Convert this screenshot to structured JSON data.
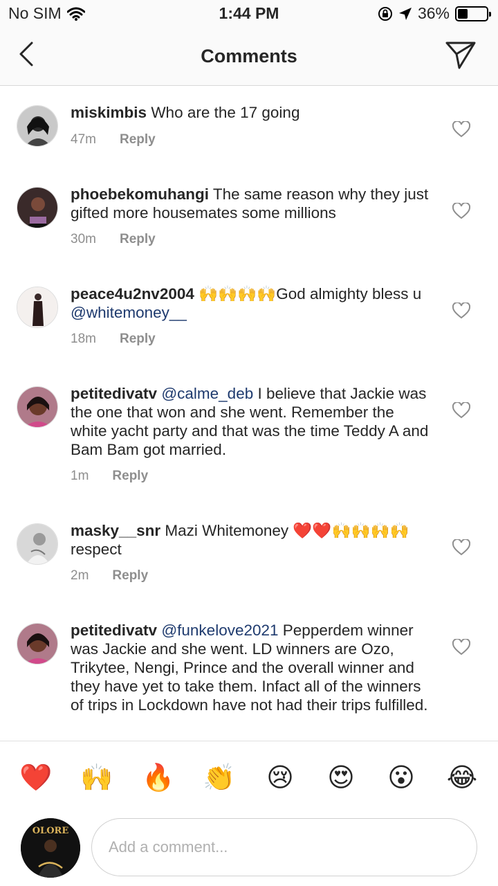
{
  "status_bar": {
    "carrier": "No SIM",
    "time": "1:44 PM",
    "battery_text": "36%",
    "battery_level": 0.36
  },
  "header": {
    "title": "Comments"
  },
  "comments": [
    {
      "user": "miskimbis",
      "parts": [
        {
          "type": "text",
          "value": " Who are the 17 going"
        }
      ],
      "time": "47m",
      "reply": "Reply"
    },
    {
      "user": "phoebekomuhangi",
      "parts": [
        {
          "type": "text",
          "value": " The same reason why they just gifted more housemates some millions"
        }
      ],
      "time": "30m",
      "reply": "Reply"
    },
    {
      "user": "peace4u2nv2004",
      "parts": [
        {
          "type": "text",
          "value": " 🙌🙌🙌🙌God almighty bless u "
        },
        {
          "type": "mention",
          "value": "@whitemoney__"
        }
      ],
      "time": "18m",
      "reply": "Reply"
    },
    {
      "user": "petitedivatv",
      "parts": [
        {
          "type": "text",
          "value": " "
        },
        {
          "type": "mention",
          "value": "@calme_deb"
        },
        {
          "type": "text",
          "value": " I believe that Jackie was the one that won and she went. Remember the white yacht party and that was the time Teddy A and Bam Bam got married."
        }
      ],
      "time": "1m",
      "reply": "Reply"
    },
    {
      "user": "masky__snr",
      "parts": [
        {
          "type": "text",
          "value": " Mazi Whitemoney ❤️❤️🙌🙌🙌🙌 respect"
        }
      ],
      "time": "2m",
      "reply": "Reply"
    },
    {
      "user": "petitedivatv",
      "parts": [
        {
          "type": "text",
          "value": " "
        },
        {
          "type": "mention",
          "value": "@funkelove2021"
        },
        {
          "type": "text",
          "value": " Pepperdem winner was Jackie and she went. LD winners are Ozo, Trikytee, Nengi, Prince and the overall winner and they have yet to take them. Infact all of the winners of trips in Lockdown have not had their trips fulfilled."
        }
      ],
      "time": "",
      "reply": ""
    }
  ],
  "emoji_bar": [
    "❤️",
    "🙌",
    "🔥",
    "👏",
    "😢",
    "😍",
    "😮",
    "😂"
  ],
  "composer": {
    "placeholder": "Add a comment...",
    "avatar_text": "OLORE"
  }
}
